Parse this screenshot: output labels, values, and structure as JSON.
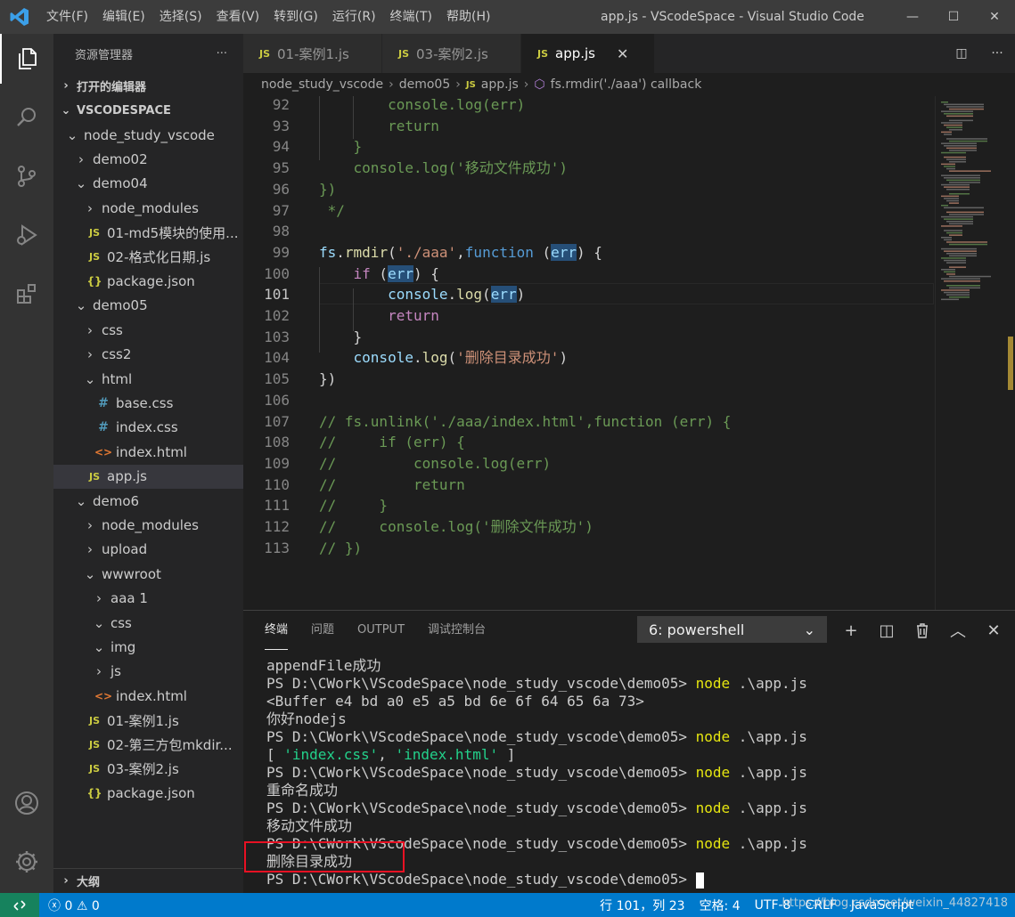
{
  "window": {
    "title": "app.js - VScodeSpace - Visual Studio Code",
    "menu": [
      "文件(F)",
      "编辑(E)",
      "选择(S)",
      "查看(V)",
      "转到(G)",
      "运行(R)",
      "终端(T)",
      "帮助(H)"
    ],
    "controls": {
      "minimize": "—",
      "maximize": "☐",
      "close": "✕"
    }
  },
  "sidebar": {
    "title": "资源管理器",
    "more": "···",
    "open_editors": "打开的编辑器",
    "workspace": "VSCODESPACE",
    "outline": "大纲",
    "tree": [
      {
        "label": "node_study_vscode",
        "type": "folder",
        "open": true,
        "depth": 1
      },
      {
        "label": "demo02",
        "type": "folder",
        "open": false,
        "depth": 2
      },
      {
        "label": "demo04",
        "type": "folder",
        "open": true,
        "depth": 2
      },
      {
        "label": "node_modules",
        "type": "folder",
        "open": false,
        "depth": 3
      },
      {
        "label": "01-md5模块的使用...",
        "type": "js",
        "depth": 3
      },
      {
        "label": "02-格式化日期.js",
        "type": "js",
        "depth": 3
      },
      {
        "label": "package.json",
        "type": "json",
        "depth": 3
      },
      {
        "label": "demo05",
        "type": "folder",
        "open": true,
        "depth": 2
      },
      {
        "label": "css",
        "type": "folder",
        "open": false,
        "depth": 3
      },
      {
        "label": "css2",
        "type": "folder",
        "open": false,
        "depth": 3
      },
      {
        "label": "html",
        "type": "folder",
        "open": true,
        "depth": 3
      },
      {
        "label": "base.css",
        "type": "css",
        "depth": 4
      },
      {
        "label": "index.css",
        "type": "css",
        "depth": 4
      },
      {
        "label": "index.html",
        "type": "html",
        "depth": 4
      },
      {
        "label": "app.js",
        "type": "js",
        "depth": 3,
        "selected": true
      },
      {
        "label": "demo6",
        "type": "folder",
        "open": true,
        "depth": 2
      },
      {
        "label": "node_modules",
        "type": "folder",
        "open": false,
        "depth": 3
      },
      {
        "label": "upload",
        "type": "folder",
        "open": false,
        "depth": 3
      },
      {
        "label": "wwwroot",
        "type": "folder",
        "open": true,
        "depth": 3
      },
      {
        "label": "aaa 1",
        "type": "folder",
        "open": false,
        "depth": 4
      },
      {
        "label": "css",
        "type": "folder",
        "open": true,
        "depth": 4
      },
      {
        "label": "img",
        "type": "folder",
        "open": true,
        "depth": 4
      },
      {
        "label": "js",
        "type": "folder",
        "open": false,
        "depth": 4
      },
      {
        "label": "index.html",
        "type": "html",
        "depth": 4
      },
      {
        "label": "01-案例1.js",
        "type": "js",
        "depth": 3
      },
      {
        "label": "02-第三方包mkdir...",
        "type": "js",
        "depth": 3
      },
      {
        "label": "03-案例2.js",
        "type": "js",
        "depth": 3
      },
      {
        "label": "package.json",
        "type": "json",
        "depth": 3
      }
    ]
  },
  "tabs": [
    {
      "label": "01-案例1.js",
      "active": false
    },
    {
      "label": "03-案例2.js",
      "active": false
    },
    {
      "label": "app.js",
      "active": true
    }
  ],
  "breadcrumb": [
    "node_study_vscode",
    "demo05",
    "app.js",
    "fs.rmdir('./aaa') callback"
  ],
  "editor": {
    "lines": [
      {
        "n": "92",
        "segs": [
          [
            "        ",
            "def"
          ],
          [
            "console",
            "var"
          ],
          [
            ".",
            "def"
          ],
          [
            "log",
            "fn"
          ],
          [
            "(",
            "def"
          ],
          [
            "err",
            "var"
          ],
          [
            ")",
            "def"
          ]
        ],
        "cm": true
      },
      {
        "n": "93",
        "segs": [
          [
            "        return",
            "kw"
          ]
        ],
        "cm": true
      },
      {
        "n": "94",
        "segs": [
          [
            "    }",
            "def"
          ]
        ],
        "cm": true
      },
      {
        "n": "95",
        "segs": [
          [
            "    console.log('移动文件成功')",
            "cm"
          ]
        ],
        "cm": true
      },
      {
        "n": "96",
        "segs": [
          [
            "})",
            "cm"
          ]
        ],
        "cm": true
      },
      {
        "n": "97",
        "segs": [
          [
            " */",
            "cm"
          ]
        ],
        "cm": true
      },
      {
        "n": "98",
        "segs": []
      },
      {
        "n": "99",
        "segs": [
          [
            "fs",
            "var"
          ],
          [
            ".",
            "def"
          ],
          [
            "rmdir",
            "fn"
          ],
          [
            "(",
            "def"
          ],
          [
            "'./aaa'",
            "str"
          ],
          [
            ",",
            "def"
          ],
          [
            "function",
            "decl"
          ],
          [
            " (",
            "def"
          ],
          [
            "err",
            "var",
            "hl"
          ],
          [
            ") {",
            "def"
          ]
        ]
      },
      {
        "n": "100",
        "segs": [
          [
            "    ",
            "def"
          ],
          [
            "if",
            "kw"
          ],
          [
            " (",
            "def"
          ],
          [
            "err",
            "var",
            "hl"
          ],
          [
            ") {",
            "def"
          ]
        ]
      },
      {
        "n": "101",
        "segs": [
          [
            "        ",
            "def"
          ],
          [
            "console",
            "var"
          ],
          [
            ".",
            "def"
          ],
          [
            "log",
            "fn"
          ],
          [
            "(",
            "def"
          ],
          [
            "err",
            "var",
            "hl"
          ],
          [
            ")",
            "def"
          ]
        ],
        "current": true
      },
      {
        "n": "102",
        "segs": [
          [
            "        ",
            "def"
          ],
          [
            "return",
            "kw"
          ]
        ]
      },
      {
        "n": "103",
        "segs": [
          [
            "    }",
            "def"
          ]
        ]
      },
      {
        "n": "104",
        "segs": [
          [
            "    ",
            "def"
          ],
          [
            "console",
            "var"
          ],
          [
            ".",
            "def"
          ],
          [
            "log",
            "fn"
          ],
          [
            "(",
            "def"
          ],
          [
            "'删除目录成功'",
            "str"
          ],
          [
            ")",
            "def"
          ]
        ]
      },
      {
        "n": "105",
        "segs": [
          [
            "})",
            "def"
          ]
        ]
      },
      {
        "n": "106",
        "segs": []
      },
      {
        "n": "107",
        "segs": [
          [
            "// fs.unlink('./aaa/index.html',function (err) {",
            "cm"
          ]
        ]
      },
      {
        "n": "108",
        "segs": [
          [
            "//     if (err) {",
            "cm"
          ]
        ]
      },
      {
        "n": "109",
        "segs": [
          [
            "//         console.log(err)",
            "cm"
          ]
        ]
      },
      {
        "n": "110",
        "segs": [
          [
            "//         return",
            "cm"
          ]
        ]
      },
      {
        "n": "111",
        "segs": [
          [
            "//     }",
            "cm"
          ]
        ]
      },
      {
        "n": "112",
        "segs": [
          [
            "//     console.log('删除文件成功')",
            "cm"
          ]
        ]
      },
      {
        "n": "113",
        "segs": [
          [
            "// })",
            "cm"
          ]
        ]
      }
    ]
  },
  "panel": {
    "tabs": [
      "终端",
      "问题",
      "OUTPUT",
      "调试控制台"
    ],
    "terminal_select": "6: powershell",
    "actions": {
      "add": "+",
      "split": "◫",
      "trash": "🗑",
      "maximize": "︿",
      "close": "✕"
    },
    "terminal_lines": [
      [
        [
          "appendFile成功",
          ""
        ]
      ],
      [
        [
          "PS D:\\CWork\\VScodeSpace\\node_study_vscode\\demo05> ",
          ""
        ],
        [
          "node",
          "cmd"
        ],
        [
          " .\\app.js",
          ""
        ]
      ],
      [
        [
          "<Buffer e4 bd a0 e5 a5 bd 6e 6f 64 65 6a 73>",
          ""
        ]
      ],
      [
        [
          "你好nodejs",
          ""
        ]
      ],
      [
        [
          "PS D:\\CWork\\VScodeSpace\\node_study_vscode\\demo05> ",
          ""
        ],
        [
          "node",
          "cmd"
        ],
        [
          " .\\app.js",
          ""
        ]
      ],
      [
        [
          "[ ",
          ""
        ],
        [
          "'index.css'",
          "str"
        ],
        [
          ", ",
          ""
        ],
        [
          "'index.html'",
          "str"
        ],
        [
          " ]",
          ""
        ]
      ],
      [
        [
          "PS D:\\CWork\\VScodeSpace\\node_study_vscode\\demo05> ",
          ""
        ],
        [
          "node",
          "cmd"
        ],
        [
          " .\\app.js",
          ""
        ]
      ],
      [
        [
          "重命名成功",
          ""
        ]
      ],
      [
        [
          "PS D:\\CWork\\VScodeSpace\\node_study_vscode\\demo05> ",
          ""
        ],
        [
          "node",
          "cmd"
        ],
        [
          " .\\app.js",
          ""
        ]
      ],
      [
        [
          "移动文件成功",
          ""
        ]
      ],
      [
        [
          "PS D:\\CWork\\VScodeSpace\\node_study_vscode\\demo05> ",
          ""
        ],
        [
          "node",
          "cmd"
        ],
        [
          " .\\app.js",
          ""
        ]
      ],
      [
        [
          "删除目录成功",
          ""
        ]
      ],
      [
        [
          "PS D:\\CWork\\VScodeSpace\\node_study_vscode\\demo05> ",
          ""
        ]
      ]
    ]
  },
  "statusbar": {
    "errors": "0",
    "warnings": "0",
    "position": "行 101，列 23",
    "spaces": "空格: 4",
    "encoding": "UTF-8",
    "eol": "CRLF",
    "language": "JavaScript",
    "watermark": "https://blog.csdn.net/weixin_44827418"
  },
  "colors": {
    "accent": "#007acc",
    "remote": "#16825d",
    "highlight_box": "#e81123"
  }
}
